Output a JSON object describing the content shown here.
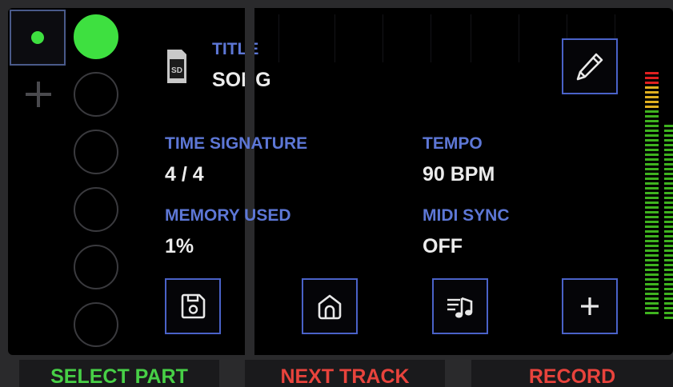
{
  "song": {
    "title_label": "TITLE",
    "title_value": "SONG",
    "sd_badge": "SD",
    "time_signature_label": "TIME SIGNATURE",
    "time_signature_value": "4 / 4",
    "tempo_label": "TEMPO",
    "tempo_value": "90 BPM",
    "memory_label": "MEMORY USED",
    "memory_value": "1%",
    "midi_sync_label": "MIDI SYNC",
    "midi_sync_value": "OFF"
  },
  "icons": {
    "edit": "pencil-icon",
    "save": "floppy-disk-icon",
    "home": "home-icon",
    "music": "music-notes-icon",
    "add": "plus-icon",
    "add_track": "plus-icon",
    "sd": "sd-card-icon"
  },
  "parts": {
    "active_index": 0,
    "count": 6
  },
  "soft_buttons": [
    {
      "label": "SELECT PART",
      "color": "#47d046"
    },
    {
      "label": "NEXT TRACK",
      "color": "#e8433c"
    },
    {
      "label": "RECORD",
      "color": "#e8433c"
    }
  ],
  "colors": {
    "accent_blue": "#5d77d6",
    "active_green": "#3ee040",
    "meter_green": "#3fb31f",
    "meter_yellow": "#e0b020",
    "meter_red": "#e02020"
  }
}
